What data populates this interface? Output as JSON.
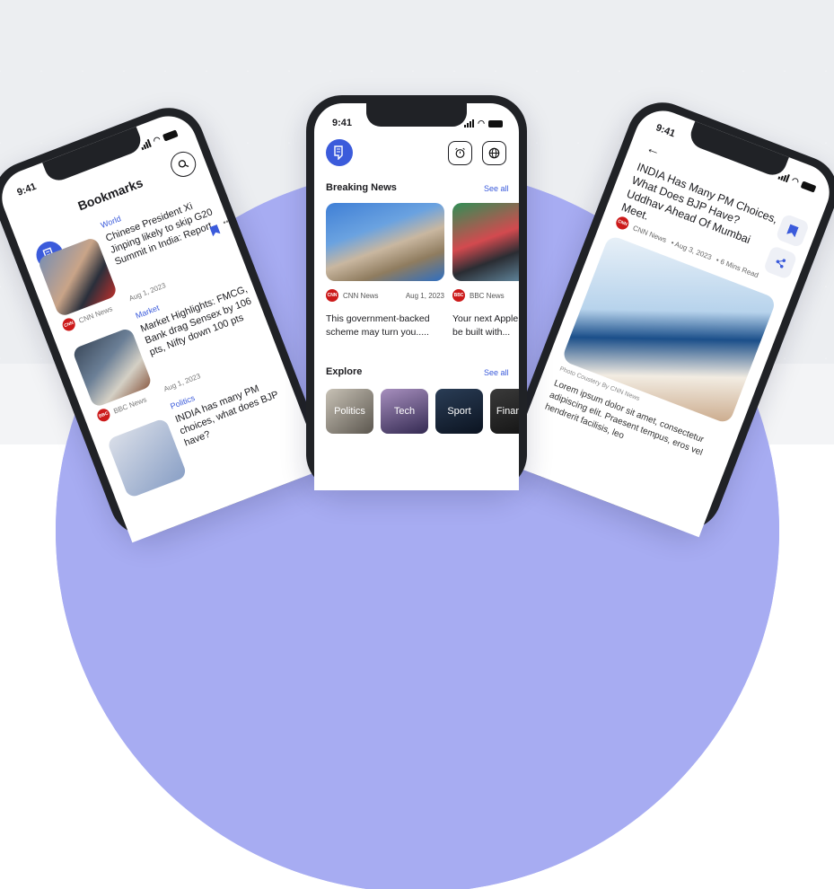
{
  "center": {
    "status_time": "9:41",
    "breaking": {
      "title": "Breaking News",
      "see_all": "See all"
    },
    "cards": [
      {
        "source": "CNN News",
        "source_badge": "CNN",
        "date": "Aug 1, 2023",
        "title": "This government-backed scheme may turn you....."
      },
      {
        "source": "BBC News",
        "source_badge": "BBC NEWS",
        "date": "",
        "title": "Your next Apple Watch may be built with..."
      }
    ],
    "explore": {
      "title": "Explore",
      "see_all": "See all",
      "tiles": [
        "Politics",
        "Tech",
        "Sport",
        "Finance"
      ]
    },
    "icons": {
      "logo": "news-logo-icon",
      "alarm": "alarm-clock-icon",
      "globe": "globe-icon"
    }
  },
  "left": {
    "status_time": "9:41",
    "title": "Bookmarks",
    "items": [
      {
        "category": "World",
        "title": "Chinese President Xi Jinping likely to skip G20 Summit in India: Report",
        "source": "CNN News",
        "date": "Aug 1, 2023"
      },
      {
        "category": "Market",
        "title": "Market Highlights: FMCG, Bank drag Sensex by 106 pts, Nifty down 100 pts",
        "source": "BBC News",
        "date": "Aug 1, 2023"
      },
      {
        "category": "Politics",
        "title": "INDIA has many PM choices, what does BJP have?",
        "source": "",
        "date": ""
      }
    ],
    "more_label": "•••"
  },
  "right": {
    "status_time": "9:41",
    "headline": "INDIA Has Many PM Choices, What Does BJP Have? Uddhav Ahead Of Mumbai Meet.",
    "source": "CNN News",
    "date": "• Aug 3, 2023",
    "read_time": "• 6 Mins Read",
    "photo_credit": "Photo Coustery By CNN News",
    "body": "Lorem ipsum dolor sit amet, consectetur adipiscing elit. Praesent tempus, eros vel hendrerit facilisis, leo"
  },
  "colors": {
    "accent": "#3b5bdb",
    "arc": "#a7acf2",
    "badge_red": "#cc1a1a"
  }
}
